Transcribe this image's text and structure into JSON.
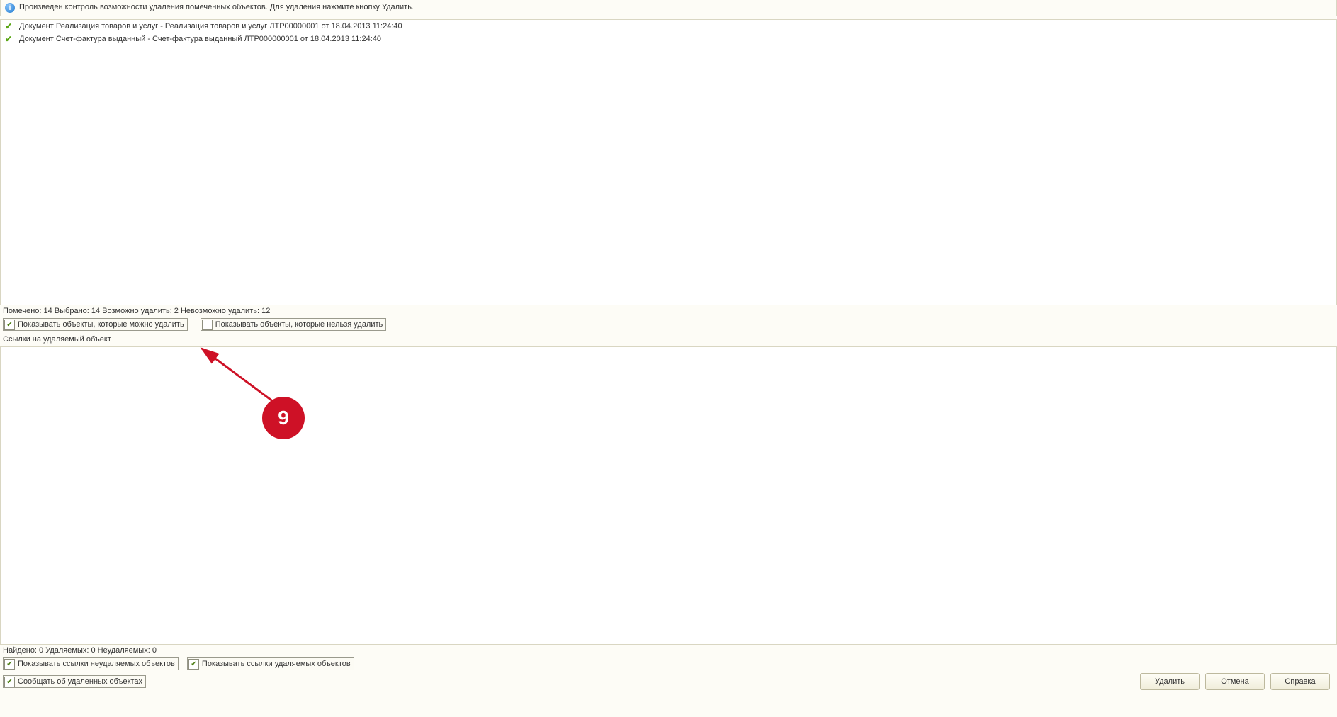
{
  "info_message": "Произведен контроль возможности удаления помеченных объектов. Для удаления нажмите кнопку Удалить.",
  "list": {
    "rows": [
      "Документ Реализация товаров и услуг - Реализация товаров и услуг ЛТР00000001 от 18.04.2013 11:24:40",
      "Документ Счет-фактура выданный - Счет-фактура выданный ЛТР000000001 от 18.04.2013 11:24:40"
    ]
  },
  "summary_line": "Помечено: 14  Выбрано: 14  Возможно удалить: 2  Невозможно удалить: 12",
  "filters": {
    "show_deletable": "Показывать объекты, которые можно удалить",
    "show_undeletable": "Показывать объекты, которые нельзя удалить"
  },
  "links_header": "Ссылки на удаляемый объект",
  "links_summary": "Найдено: 0  Удаляемых: 0  Неудаляемых: 0",
  "links_filters": {
    "show_links_undeletable": "Показывать ссылки неудаляемых объектов",
    "show_links_deletable": "Показывать ссылки удаляемых объектов"
  },
  "notify_label": "Сообщать об удаленных объектах",
  "buttons": {
    "delete": "Удалить",
    "cancel": "Отмена",
    "help": "Справка"
  },
  "annotation": {
    "number": "9"
  }
}
